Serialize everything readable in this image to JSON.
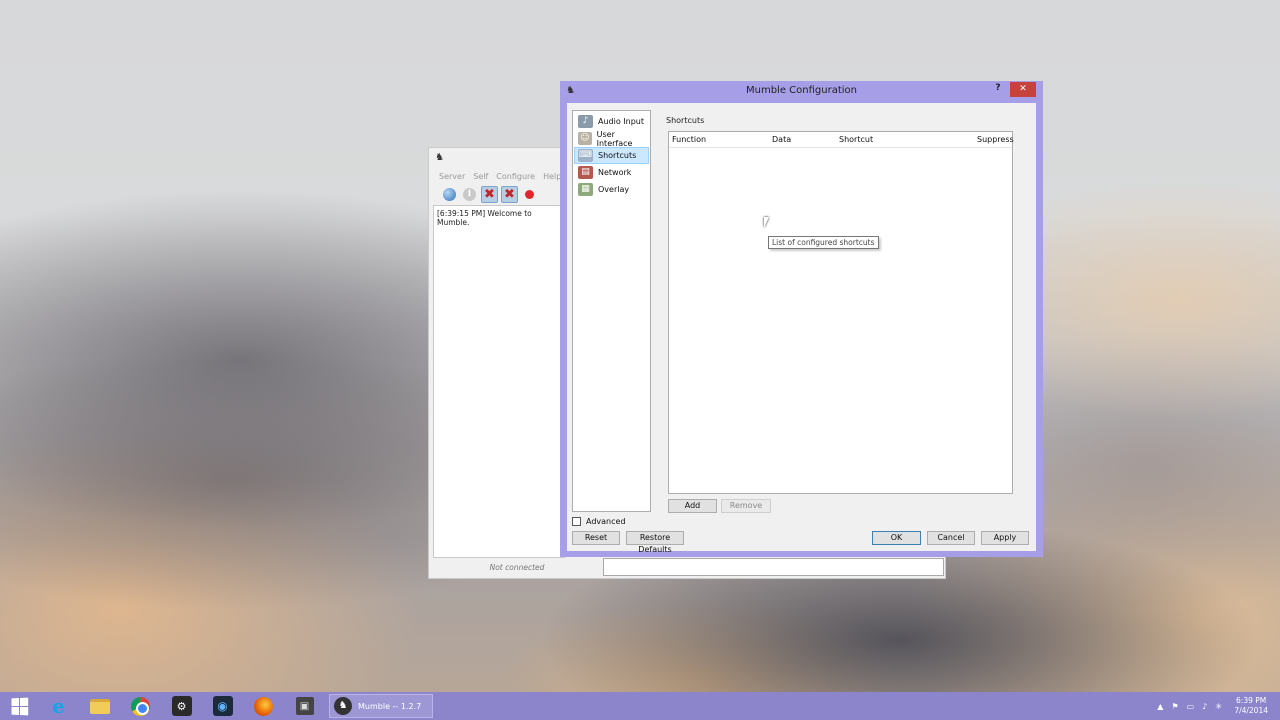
{
  "main_window": {
    "menu": [
      "Server",
      "Self",
      "Configure",
      "Help"
    ],
    "log_message": "[6:39:15 PM] Welcome to Mumble.",
    "status": "Not connected"
  },
  "dialog": {
    "title": "Mumble Configuration",
    "help_glyph": "?",
    "close_glyph": "✕",
    "categories": [
      {
        "label": "Audio Input",
        "icon": "microphone-icon"
      },
      {
        "label": "User Interface",
        "icon": "user-interface-icon"
      },
      {
        "label": "Shortcuts",
        "icon": "shortcuts-icon",
        "selected": true
      },
      {
        "label": "Network",
        "icon": "network-icon"
      },
      {
        "label": "Overlay",
        "icon": "overlay-icon"
      }
    ],
    "section_label": "Shortcuts",
    "columns": {
      "function": "Function",
      "data": "Data",
      "shortcut": "Shortcut",
      "suppress": "Suppress"
    },
    "add_label": "Add",
    "remove_label": "Remove",
    "advanced_label": "Advanced",
    "reset_label": "Reset",
    "restore_defaults_label": "Restore Defaults",
    "ok_label": "OK",
    "cancel_label": "Cancel",
    "apply_label": "Apply"
  },
  "tooltip": "List of configured shortcuts",
  "taskbar": {
    "mumble_task_label": "Mumble -- 1.2.7",
    "time": "6:39 PM",
    "date": "7/4/2014"
  },
  "colors": {
    "dialog_frame": "#a69ee6",
    "taskbar": "#8c85cc",
    "close_button": "#c7423b",
    "selection": "#cce8ff"
  }
}
